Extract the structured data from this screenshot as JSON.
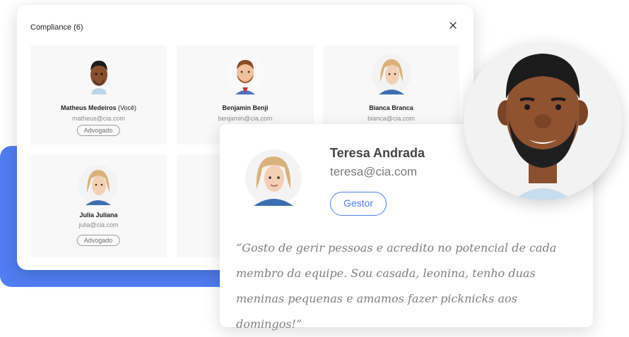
{
  "modal": {
    "title": "Compliance (6)",
    "members": [
      {
        "name": "Matheus Medeiros",
        "suffix": "(Você)",
        "email": "matheus@cia.com",
        "role": "Advogado"
      },
      {
        "name": "Benjamin Benji",
        "email": "benjamin@cia.com"
      },
      {
        "name": "Bianca Branca",
        "email": "bianca@cia.com"
      },
      {
        "name": "Julia Juliana",
        "email": "julia@cia.com",
        "role": "Advogado"
      }
    ]
  },
  "profile_card": {
    "name": "Teresa Andrada",
    "email": "teresa@cia.com",
    "role": "Gestor",
    "quote": "“Gosto de gerir pessoas e acredito no potencial de cada membro da equipe. Sou casada, leonina, tenho duas meninas pequenas e amamos fazer picknicks aos domingos!”"
  },
  "colors": {
    "accent": "#4f7df2",
    "badge_border": "#9a9a9a",
    "tile_background": "#f8f8f8"
  },
  "icons": [
    "close-icon",
    "avatar-illustration"
  ]
}
